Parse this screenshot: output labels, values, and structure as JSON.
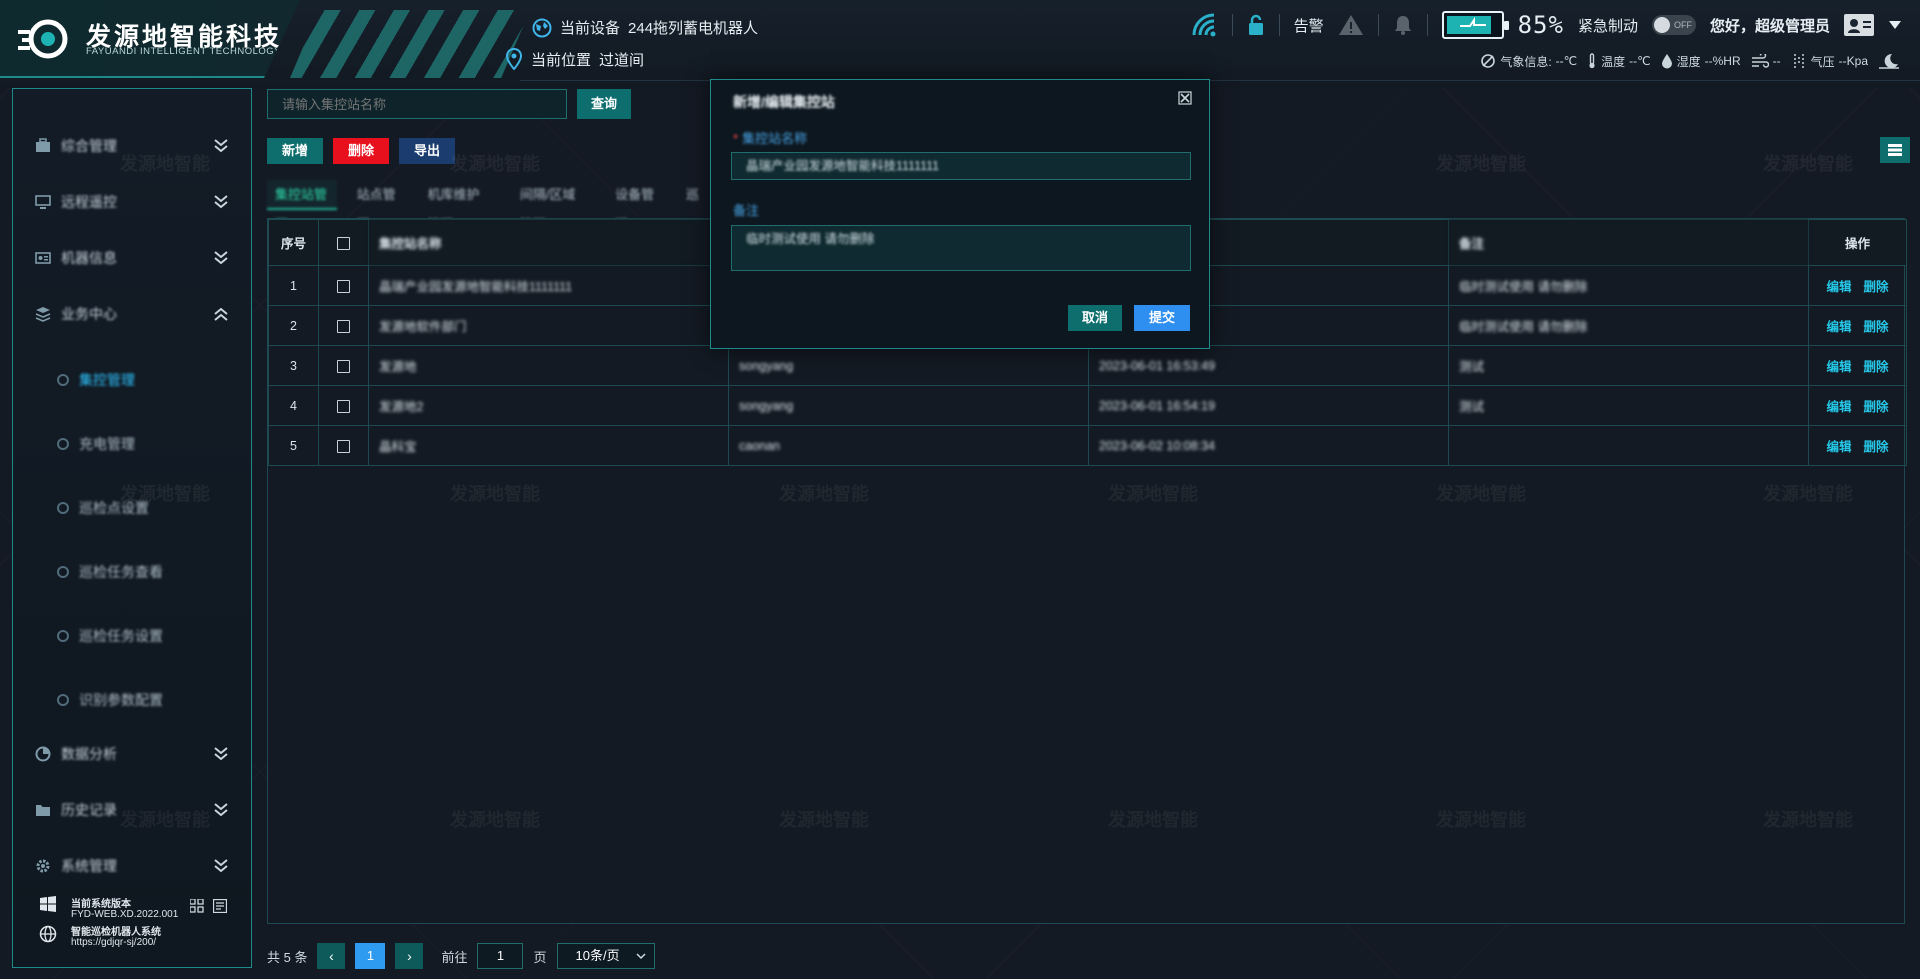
{
  "brand": {
    "name_cn": "发源地智能科技",
    "name_en": "FAYUANDI INTELLIGENT TECHNOLOGY"
  },
  "header": {
    "device_label": "当前设备",
    "device_value": "244拖列蓄电机器人",
    "location_label": "当前位置",
    "location_value": "过道间",
    "alarm_label": "告警",
    "battery_pct": "85%",
    "battery_level": 0.85,
    "emergency_label": "紧急制动",
    "toggle_state": "OFF",
    "greeting": "您好，超级管理员",
    "weather": {
      "info_label": "气象信息:",
      "info_value": "--℃",
      "temp_label": "温度",
      "temp_value": "--℃",
      "humidity_label": "湿度",
      "humidity_value": "--%HR",
      "wind_value": "--",
      "pressure_label": "气压",
      "pressure_value": "--Kpa"
    }
  },
  "sidebar": {
    "items": [
      {
        "label": "综合管理",
        "icon": "briefcase-icon"
      },
      {
        "label": "远程遥控",
        "icon": "monitor-icon"
      },
      {
        "label": "机器信息",
        "icon": "id-card-icon"
      },
      {
        "label": "业务中心",
        "icon": "stack-icon"
      }
    ],
    "sub_items": [
      {
        "label": "集控管理"
      },
      {
        "label": "充电管理"
      },
      {
        "label": "巡检点设置"
      },
      {
        "label": "巡检任务查看"
      },
      {
        "label": "巡检任务设置"
      },
      {
        "label": "识别参数配置"
      }
    ],
    "items_bottom": [
      {
        "label": "数据分析",
        "icon": "chart-icon"
      },
      {
        "label": "历史记录",
        "icon": "folder-icon"
      },
      {
        "label": "系统管理",
        "icon": "gear-icon"
      }
    ],
    "footer": {
      "version_label": "当前系统版本",
      "version_value": "FYD-WEB.XD.2022.001",
      "system_name": "智能巡检机器人系统",
      "url": "https://gdjqr-sj/200/"
    }
  },
  "toolbar": {
    "search_placeholder": "请输入集控站名称",
    "query_label": "查询",
    "add_label": "新增",
    "delete_label": "删除",
    "export_label": "导出"
  },
  "tabs": [
    "集控站管理",
    "站点管理",
    "机库维护管理",
    "间隔/区域管理",
    "设备管理",
    "巡"
  ],
  "table": {
    "headers": [
      "序号",
      "",
      "集控站名称",
      "",
      "",
      "备注",
      "操作"
    ],
    "rows": [
      {
        "no": "1",
        "name": "晶瑞产业园发源地智能科技1111111",
        "user": "",
        "time": "",
        "remark": "临时测试使用 请勿删除"
      },
      {
        "no": "2",
        "name": "发源地软件部门",
        "user": "",
        "time": "",
        "remark": "临时测试使用 请勿删除"
      },
      {
        "no": "3",
        "name": "发源地",
        "user": "songyang",
        "time": "2023-06-01 16:53:49",
        "remark": "测试"
      },
      {
        "no": "4",
        "name": "发源地2",
        "user": "songyang",
        "time": "2023-06-01 16:54:19",
        "remark": "测试"
      },
      {
        "no": "5",
        "name": "晶科宝",
        "user": "caonan",
        "time": "2023-06-02 10:08:34",
        "remark": ""
      }
    ],
    "edit_label": "编辑",
    "delete_label": "删除"
  },
  "pagination": {
    "total_label": "共 5 条",
    "current_page": "1",
    "goto_label": "前往",
    "goto_value": "1",
    "page_suffix": "页",
    "page_size": "10条/页"
  },
  "modal": {
    "title": "新增/编辑集控站",
    "field1_label": "集控站名称",
    "field1_value": "晶瑞产业园发源地智能科技1111111",
    "field2_label": "备注",
    "field2_value": "临时测试使用 请勿删除",
    "cancel_label": "取消",
    "submit_label": "提交"
  },
  "watermark": "发源地智能",
  "colors": {
    "accent": "#1f8a8a",
    "primary_btn": "#0e6e6e",
    "danger": "#e8101c",
    "submit": "#2e8ff0",
    "link": "#25c8e8"
  }
}
